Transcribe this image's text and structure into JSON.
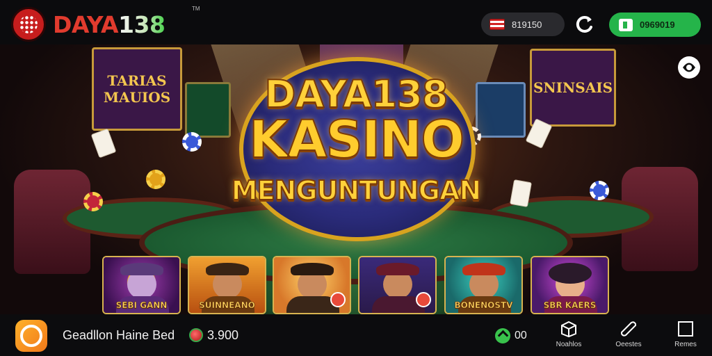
{
  "header": {
    "brand_prefix": "DAYA",
    "brand_number": "138",
    "trademark": "TM",
    "balance": "819150",
    "deposit_label": "0969019"
  },
  "hero": {
    "title_line1": "DAYA138",
    "title_line2": "KASINO",
    "title_line3": "MENGUNTUNGAN",
    "panel_left_text": "TARIAS MAUIOS",
    "panel_right_text": "SNINSAIS",
    "games": [
      {
        "label": "SEBI GANN"
      },
      {
        "label": "SUINNEANO"
      },
      {
        "label": ""
      },
      {
        "label": ""
      },
      {
        "label": "BONENOSTV"
      },
      {
        "label": "SBR KAERS"
      }
    ]
  },
  "footer": {
    "player_name": "Geadllon Haine Bed",
    "balance": "3.900",
    "online_count": "00",
    "nav": [
      {
        "label": "Noahlos",
        "icon": "box-icon"
      },
      {
        "label": "Oeestes",
        "icon": "ticket-icon"
      },
      {
        "label": "Remes",
        "icon": "square-icon"
      }
    ]
  },
  "colors": {
    "accent_green": "#25b44a",
    "brand_red": "#e13b2e",
    "title_gold": "#ffd13a"
  }
}
